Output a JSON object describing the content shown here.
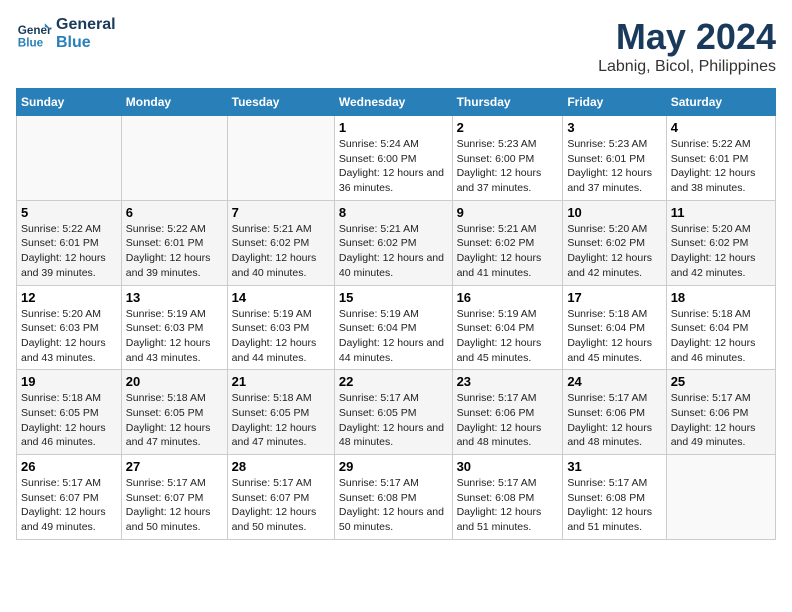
{
  "logo": {
    "line1": "General",
    "line2": "Blue"
  },
  "title": "May 2024",
  "subtitle": "Labnig, Bicol, Philippines",
  "days_of_week": [
    "Sunday",
    "Monday",
    "Tuesday",
    "Wednesday",
    "Thursday",
    "Friday",
    "Saturday"
  ],
  "weeks": [
    [
      {
        "day": "",
        "sunrise": "",
        "sunset": "",
        "daylight": ""
      },
      {
        "day": "",
        "sunrise": "",
        "sunset": "",
        "daylight": ""
      },
      {
        "day": "",
        "sunrise": "",
        "sunset": "",
        "daylight": ""
      },
      {
        "day": "1",
        "sunrise": "Sunrise: 5:24 AM",
        "sunset": "Sunset: 6:00 PM",
        "daylight": "Daylight: 12 hours and 36 minutes."
      },
      {
        "day": "2",
        "sunrise": "Sunrise: 5:23 AM",
        "sunset": "Sunset: 6:00 PM",
        "daylight": "Daylight: 12 hours and 37 minutes."
      },
      {
        "day": "3",
        "sunrise": "Sunrise: 5:23 AM",
        "sunset": "Sunset: 6:01 PM",
        "daylight": "Daylight: 12 hours and 37 minutes."
      },
      {
        "day": "4",
        "sunrise": "Sunrise: 5:22 AM",
        "sunset": "Sunset: 6:01 PM",
        "daylight": "Daylight: 12 hours and 38 minutes."
      }
    ],
    [
      {
        "day": "5",
        "sunrise": "Sunrise: 5:22 AM",
        "sunset": "Sunset: 6:01 PM",
        "daylight": "Daylight: 12 hours and 39 minutes."
      },
      {
        "day": "6",
        "sunrise": "Sunrise: 5:22 AM",
        "sunset": "Sunset: 6:01 PM",
        "daylight": "Daylight: 12 hours and 39 minutes."
      },
      {
        "day": "7",
        "sunrise": "Sunrise: 5:21 AM",
        "sunset": "Sunset: 6:02 PM",
        "daylight": "Daylight: 12 hours and 40 minutes."
      },
      {
        "day": "8",
        "sunrise": "Sunrise: 5:21 AM",
        "sunset": "Sunset: 6:02 PM",
        "daylight": "Daylight: 12 hours and 40 minutes."
      },
      {
        "day": "9",
        "sunrise": "Sunrise: 5:21 AM",
        "sunset": "Sunset: 6:02 PM",
        "daylight": "Daylight: 12 hours and 41 minutes."
      },
      {
        "day": "10",
        "sunrise": "Sunrise: 5:20 AM",
        "sunset": "Sunset: 6:02 PM",
        "daylight": "Daylight: 12 hours and 42 minutes."
      },
      {
        "day": "11",
        "sunrise": "Sunrise: 5:20 AM",
        "sunset": "Sunset: 6:02 PM",
        "daylight": "Daylight: 12 hours and 42 minutes."
      }
    ],
    [
      {
        "day": "12",
        "sunrise": "Sunrise: 5:20 AM",
        "sunset": "Sunset: 6:03 PM",
        "daylight": "Daylight: 12 hours and 43 minutes."
      },
      {
        "day": "13",
        "sunrise": "Sunrise: 5:19 AM",
        "sunset": "Sunset: 6:03 PM",
        "daylight": "Daylight: 12 hours and 43 minutes."
      },
      {
        "day": "14",
        "sunrise": "Sunrise: 5:19 AM",
        "sunset": "Sunset: 6:03 PM",
        "daylight": "Daylight: 12 hours and 44 minutes."
      },
      {
        "day": "15",
        "sunrise": "Sunrise: 5:19 AM",
        "sunset": "Sunset: 6:04 PM",
        "daylight": "Daylight: 12 hours and 44 minutes."
      },
      {
        "day": "16",
        "sunrise": "Sunrise: 5:19 AM",
        "sunset": "Sunset: 6:04 PM",
        "daylight": "Daylight: 12 hours and 45 minutes."
      },
      {
        "day": "17",
        "sunrise": "Sunrise: 5:18 AM",
        "sunset": "Sunset: 6:04 PM",
        "daylight": "Daylight: 12 hours and 45 minutes."
      },
      {
        "day": "18",
        "sunrise": "Sunrise: 5:18 AM",
        "sunset": "Sunset: 6:04 PM",
        "daylight": "Daylight: 12 hours and 46 minutes."
      }
    ],
    [
      {
        "day": "19",
        "sunrise": "Sunrise: 5:18 AM",
        "sunset": "Sunset: 6:05 PM",
        "daylight": "Daylight: 12 hours and 46 minutes."
      },
      {
        "day": "20",
        "sunrise": "Sunrise: 5:18 AM",
        "sunset": "Sunset: 6:05 PM",
        "daylight": "Daylight: 12 hours and 47 minutes."
      },
      {
        "day": "21",
        "sunrise": "Sunrise: 5:18 AM",
        "sunset": "Sunset: 6:05 PM",
        "daylight": "Daylight: 12 hours and 47 minutes."
      },
      {
        "day": "22",
        "sunrise": "Sunrise: 5:17 AM",
        "sunset": "Sunset: 6:05 PM",
        "daylight": "Daylight: 12 hours and 48 minutes."
      },
      {
        "day": "23",
        "sunrise": "Sunrise: 5:17 AM",
        "sunset": "Sunset: 6:06 PM",
        "daylight": "Daylight: 12 hours and 48 minutes."
      },
      {
        "day": "24",
        "sunrise": "Sunrise: 5:17 AM",
        "sunset": "Sunset: 6:06 PM",
        "daylight": "Daylight: 12 hours and 48 minutes."
      },
      {
        "day": "25",
        "sunrise": "Sunrise: 5:17 AM",
        "sunset": "Sunset: 6:06 PM",
        "daylight": "Daylight: 12 hours and 49 minutes."
      }
    ],
    [
      {
        "day": "26",
        "sunrise": "Sunrise: 5:17 AM",
        "sunset": "Sunset: 6:07 PM",
        "daylight": "Daylight: 12 hours and 49 minutes."
      },
      {
        "day": "27",
        "sunrise": "Sunrise: 5:17 AM",
        "sunset": "Sunset: 6:07 PM",
        "daylight": "Daylight: 12 hours and 50 minutes."
      },
      {
        "day": "28",
        "sunrise": "Sunrise: 5:17 AM",
        "sunset": "Sunset: 6:07 PM",
        "daylight": "Daylight: 12 hours and 50 minutes."
      },
      {
        "day": "29",
        "sunrise": "Sunrise: 5:17 AM",
        "sunset": "Sunset: 6:08 PM",
        "daylight": "Daylight: 12 hours and 50 minutes."
      },
      {
        "day": "30",
        "sunrise": "Sunrise: 5:17 AM",
        "sunset": "Sunset: 6:08 PM",
        "daylight": "Daylight: 12 hours and 51 minutes."
      },
      {
        "day": "31",
        "sunrise": "Sunrise: 5:17 AM",
        "sunset": "Sunset: 6:08 PM",
        "daylight": "Daylight: 12 hours and 51 minutes."
      },
      {
        "day": "",
        "sunrise": "",
        "sunset": "",
        "daylight": ""
      }
    ]
  ]
}
